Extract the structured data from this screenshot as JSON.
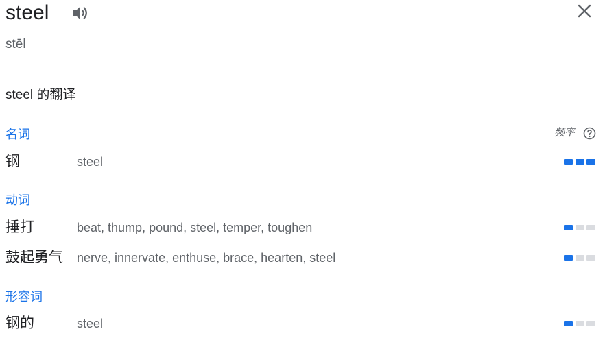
{
  "word": "steel",
  "phonetic": "stēl",
  "section_title": "steel 的翻译",
  "frequency_label": "频率",
  "icons": {
    "speaker": "speaker-icon",
    "close": "close-icon",
    "help": "help-circle-icon"
  },
  "colors": {
    "accent": "#1a73e8",
    "inactive_bar": "#dadce0",
    "text": "#202124",
    "muted": "#5f6368"
  },
  "groups": [
    {
      "pos": "名词",
      "entries": [
        {
          "term": "钢",
          "synonyms": "steel",
          "frequency": 3
        }
      ]
    },
    {
      "pos": "动词",
      "entries": [
        {
          "term": "捶打",
          "synonyms": "beat, thump, pound, steel, temper, toughen",
          "frequency": 1
        },
        {
          "term": "鼓起勇气",
          "synonyms": "nerve, innervate, enthuse, brace, hearten, steel",
          "frequency": 1
        }
      ]
    },
    {
      "pos": "形容词",
      "entries": [
        {
          "term": "钢的",
          "synonyms": "steel",
          "frequency": 1
        }
      ]
    }
  ]
}
